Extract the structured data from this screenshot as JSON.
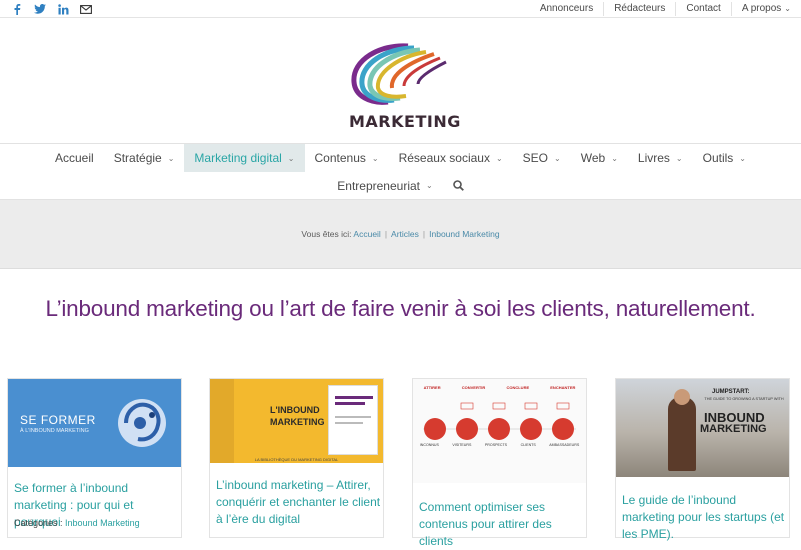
{
  "topbar": {
    "social": [
      {
        "icon": "facebook-icon",
        "glyph": "f"
      },
      {
        "icon": "twitter-icon",
        "glyph": "t"
      },
      {
        "icon": "linkedin-icon",
        "glyph": "in"
      },
      {
        "icon": "mail-icon",
        "glyph": "✉"
      }
    ],
    "links": [
      "Annonceurs",
      "Rédacteurs",
      "Contact",
      "A propos"
    ]
  },
  "logo": {
    "text": "MARKETING"
  },
  "nav": {
    "row1": [
      {
        "label": "Accueil",
        "dropdown": false
      },
      {
        "label": "Stratégie",
        "dropdown": true
      },
      {
        "label": "Marketing digital",
        "dropdown": true,
        "active": true
      },
      {
        "label": "Contenus",
        "dropdown": true
      },
      {
        "label": "Réseaux sociaux",
        "dropdown": true
      },
      {
        "label": "SEO",
        "dropdown": true
      },
      {
        "label": "Web",
        "dropdown": true
      },
      {
        "label": "Livres",
        "dropdown": true
      },
      {
        "label": "Outils",
        "dropdown": true
      }
    ],
    "row2": [
      {
        "label": "Entrepreneuriat",
        "dropdown": true
      }
    ]
  },
  "breadcrumb": {
    "prefix": "Vous êtes ici:",
    "items": [
      "Accueil",
      "Articles",
      "Inbound Marketing"
    ]
  },
  "page_title": "L’inbound marketing ou l’art de faire venir à soi les clients, naturellement.",
  "cards": [
    {
      "thumb_text_1": "SE FORMER",
      "thumb_text_2": "À L'INBOUND MARKETING",
      "title": "Se former à l’inbound marketing : pour qui et pourquoi",
      "meta_label": "Catégories :",
      "meta_value": "Inbound Marketing"
    },
    {
      "thumb_text_1": "L'INBOUND",
      "thumb_text_2": "MARKETING",
      "thumb_text_3": "LA BIBLIOTHÈQUE DU MARKETING DIGITAL",
      "title": "L’inbound marketing – Attirer, conquérir et enchanter le client à l’ère du digital"
    },
    {
      "thumb_labels": [
        "ATTIRER",
        "CONVERTIR",
        "CONCLURE",
        "ENCHANTER"
      ],
      "thumb_bottom": [
        "INCONNUS",
        "VISITEURS",
        "PROSPECTS",
        "CLIENTS",
        "AMBASSADEURS"
      ],
      "title": "Comment optimiser ses contenus pour attirer des clients"
    },
    {
      "thumb_text_1": "JUMPSTART:",
      "thumb_text_2": "THE GUIDE TO GROWING A STARTUP WITH",
      "thumb_text_3": "INBOUND",
      "thumb_text_4": "MARKETING",
      "title": "Le guide de l’inbound marketing pour les startups (et les PME)."
    }
  ],
  "colors": {
    "accent": "#2aa0a0",
    "title_purple": "#6a2a7a",
    "social_blue": "#2f80c1",
    "band_gray": "#ececec"
  }
}
